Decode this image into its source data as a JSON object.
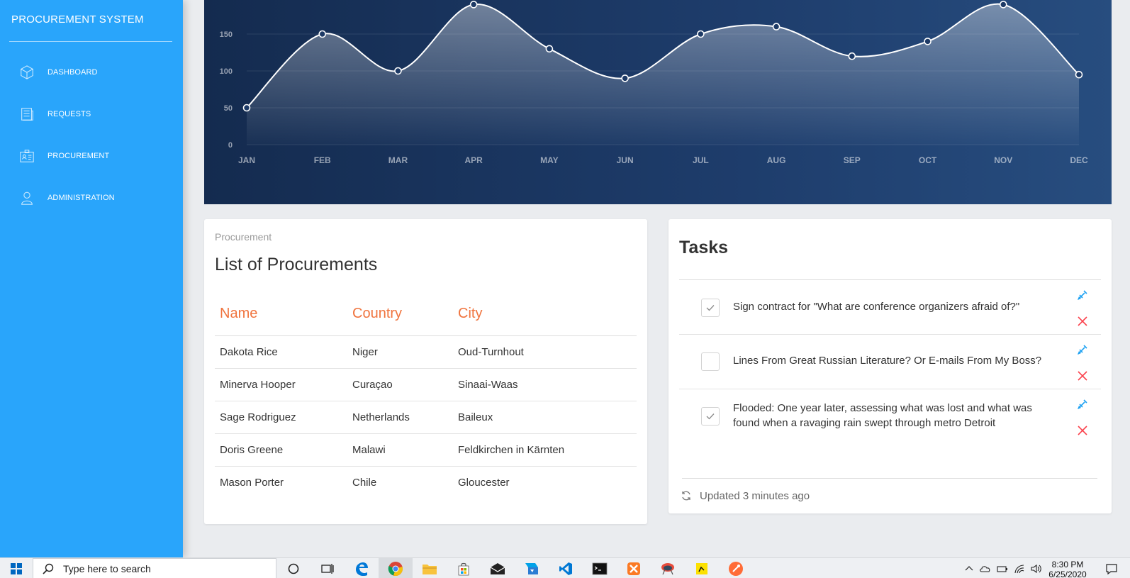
{
  "sidebar": {
    "brand": "PROCUREMENT SYSTEM",
    "items": [
      {
        "label": "DASHBOARD",
        "icon": "box-icon"
      },
      {
        "label": "REQUESTS",
        "icon": "document-list-icon"
      },
      {
        "label": "PROCUREMENT",
        "icon": "id-card-icon"
      },
      {
        "label": "ADMINISTRATION",
        "icon": "user-icon"
      }
    ]
  },
  "chart_data": {
    "type": "line",
    "categories": [
      "JAN",
      "FEB",
      "MAR",
      "APR",
      "MAY",
      "JUN",
      "JUL",
      "AUG",
      "SEP",
      "OCT",
      "NOV",
      "DEC"
    ],
    "values": [
      50,
      150,
      100,
      190,
      130,
      90,
      150,
      160,
      120,
      140,
      190,
      95
    ],
    "y_ticks": [
      "0",
      "50",
      "100",
      "150"
    ],
    "ylim": [
      0,
      200
    ],
    "grid": true,
    "line_color": "#ffffff",
    "area_fill": "rgba(255,255,255,0.35)"
  },
  "procurement": {
    "category": "Procurement",
    "title": "List of Procurements",
    "headers": [
      "Name",
      "Country",
      "City"
    ],
    "rows": [
      [
        "Dakota Rice",
        "Niger",
        "Oud-Turnhout"
      ],
      [
        "Minerva Hooper",
        "Curaçao",
        "Sinaai-Waas"
      ],
      [
        "Sage Rodriguez",
        "Netherlands",
        "Baileux"
      ],
      [
        "Doris Greene",
        "Malawi",
        "Feldkirchen in Kärnten"
      ],
      [
        "Mason Porter",
        "Chile",
        "Gloucester"
      ]
    ]
  },
  "tasks": {
    "title": "Tasks",
    "items": [
      {
        "text": "Sign contract for \"What are conference organizers afraid of?\"",
        "checked": true
      },
      {
        "text": "Lines From Great Russian Literature? Or E-mails From My Boss?",
        "checked": false
      },
      {
        "text": "Flooded: One year later, assessing what was lost and what was found when a ravaging rain swept through metro Detroit",
        "checked": true
      }
    ],
    "footer": "Updated 3 minutes ago"
  },
  "taskbar": {
    "search_placeholder": "Type here to search",
    "time": "8:30 PM",
    "date": "6/25/2020"
  },
  "colors": {
    "sidebar": "#29a5fb",
    "table_header": "#f0743e",
    "edit_icon": "#1da1f2",
    "delete_icon": "#fb404b"
  }
}
